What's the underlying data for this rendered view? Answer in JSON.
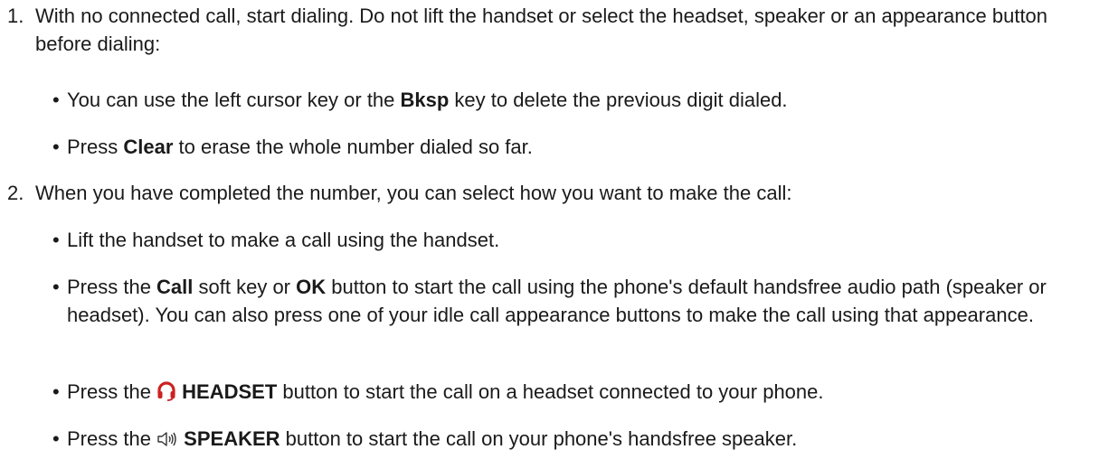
{
  "steps": [
    {
      "number": "1.",
      "text": "With no connected call, start dialing. Do not lift the handset or select the headset, speaker or an appearance button before dialing:",
      "bullets": [
        {
          "pre": "You can use the left cursor key or the ",
          "bold": "Bksp",
          "post": " key to delete the previous digit dialed."
        },
        {
          "pre": "Press ",
          "bold": "Clear",
          "post": " to erase the whole number dialed so far."
        }
      ]
    },
    {
      "number": "2.",
      "text": "When you have completed the number, you can select how you want to make the call:",
      "bullets": [
        {
          "text": "Lift the handset to make a call using the handset."
        },
        {
          "pre": "Press the ",
          "bold": "Call",
          "mid": " soft key or ",
          "bold2": "OK",
          "post": " button to start the call using the phone's default handsfree audio path (speaker or headset). You can also press one of your idle call appearance buttons to make the call using that appearance."
        },
        {
          "pre": "Press the ",
          "icon": "headset-icon",
          "bold": "HEADSET",
          "post": " button to start the call on a headset connected to your phone."
        },
        {
          "pre": "Press the ",
          "icon": "speaker-icon",
          "bold": "SPEAKER",
          "post": " button to start the call on your phone's handsfree speaker."
        }
      ]
    }
  ],
  "colors": {
    "text": "#1a1a1a",
    "headset_icon": "#cc2222",
    "speaker_icon": "#333333"
  }
}
